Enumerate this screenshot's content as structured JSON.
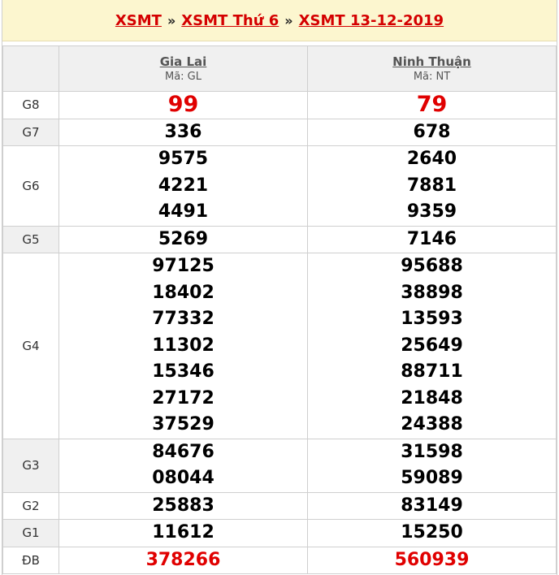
{
  "breadcrumb": {
    "item1": "XSMT",
    "item2": "XSMT Thứ 6",
    "item3": "XSMT 13-12-2019",
    "separator": "»"
  },
  "provinces": [
    {
      "name": "Gia Lai",
      "code": "Mã: GL"
    },
    {
      "name": "Ninh Thuận",
      "code": "Mã: NT"
    }
  ],
  "prizes": [
    {
      "label": "G8",
      "shaded": false,
      "red": true,
      "values": [
        [
          "99"
        ],
        [
          "79"
        ]
      ]
    },
    {
      "label": "G7",
      "shaded": true,
      "values": [
        [
          "336"
        ],
        [
          "678"
        ]
      ]
    },
    {
      "label": "G6",
      "shaded": false,
      "values": [
        [
          "9575",
          "4221",
          "4491"
        ],
        [
          "2640",
          "7881",
          "9359"
        ]
      ]
    },
    {
      "label": "G5",
      "shaded": true,
      "values": [
        [
          "5269"
        ],
        [
          "7146"
        ]
      ]
    },
    {
      "label": "G4",
      "shaded": false,
      "values": [
        [
          "97125",
          "18402",
          "77332",
          "11302",
          "15346",
          "27172",
          "37529"
        ],
        [
          "95688",
          "38898",
          "13593",
          "25649",
          "88711",
          "21848",
          "24388"
        ]
      ]
    },
    {
      "label": "G3",
      "shaded": true,
      "values": [
        [
          "84676",
          "08044"
        ],
        [
          "31598",
          "59089"
        ]
      ]
    },
    {
      "label": "G2",
      "shaded": false,
      "values": [
        [
          "25883"
        ],
        [
          "83149"
        ]
      ]
    },
    {
      "label": "G1",
      "shaded": true,
      "values": [
        [
          "11612"
        ],
        [
          "15250"
        ]
      ]
    },
    {
      "label": "ĐB",
      "shaded": false,
      "red_db": true,
      "values": [
        [
          "378266"
        ],
        [
          "560939"
        ]
      ]
    }
  ],
  "colors": {
    "accent": "#d40000",
    "title_bg": "#fcf6cf",
    "shade": "#f0f0f0"
  }
}
